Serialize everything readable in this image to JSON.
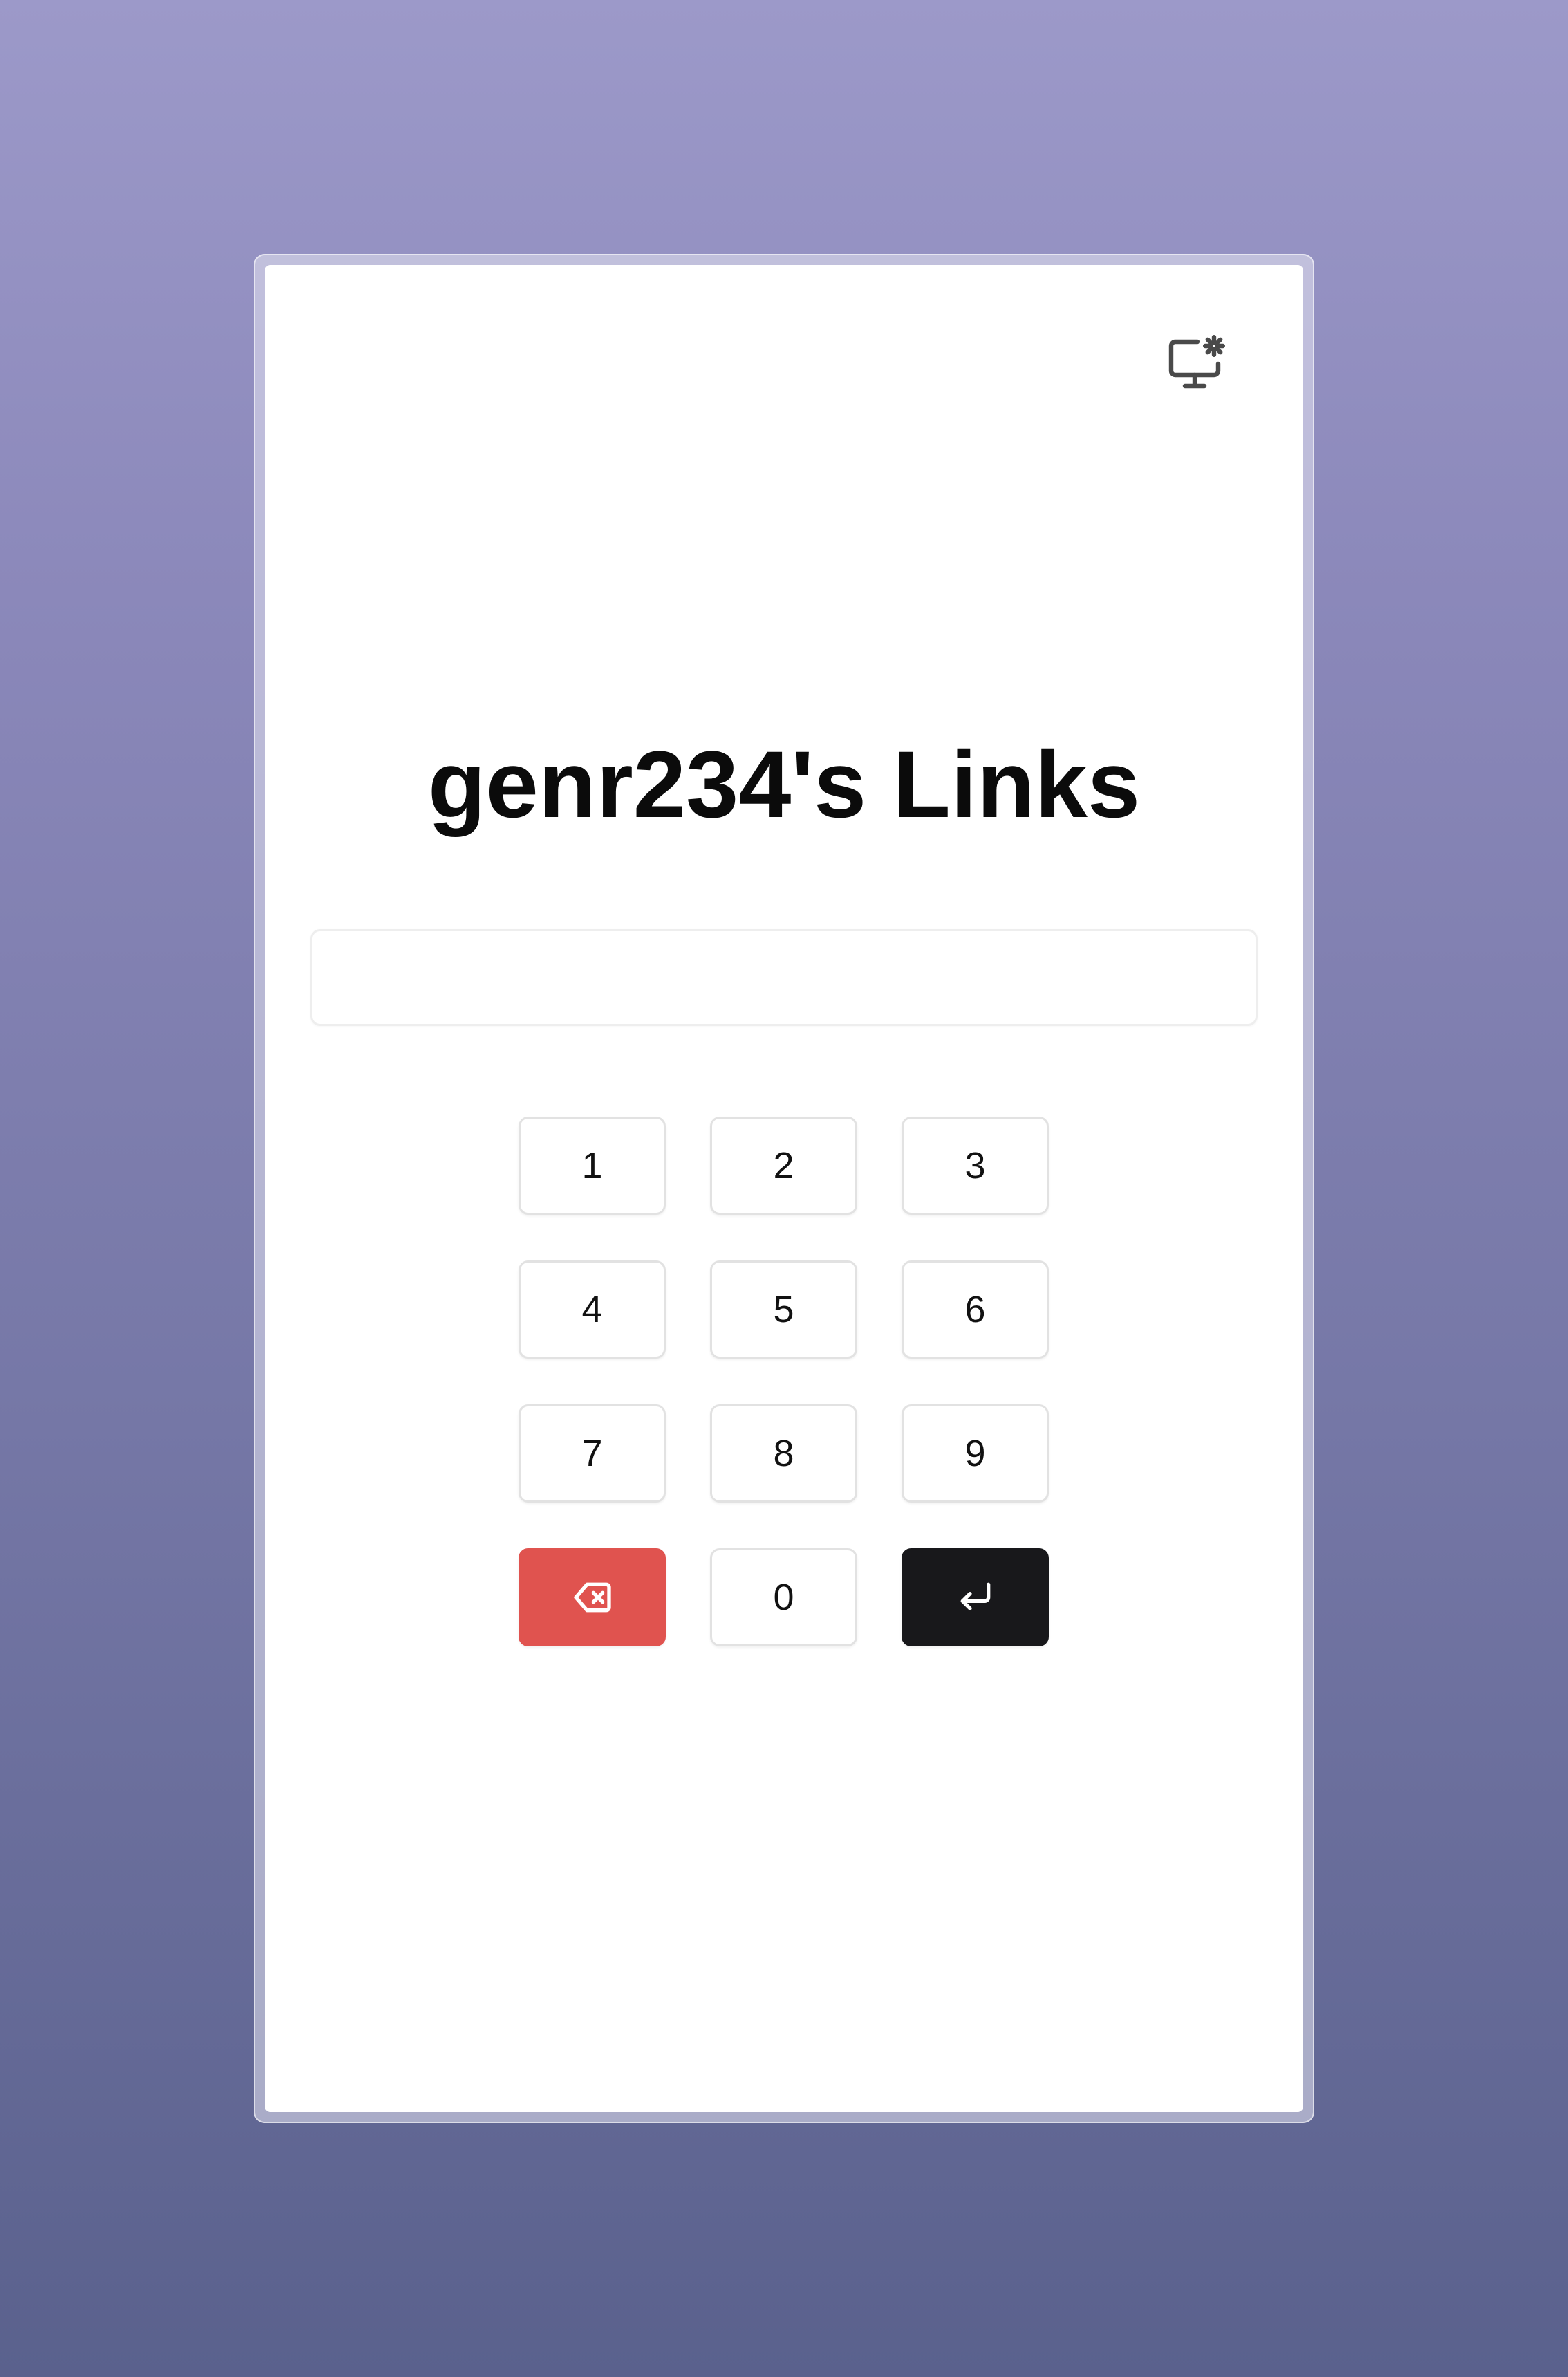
{
  "page": {
    "title": "genr234's Links"
  },
  "settings": {
    "icon": "monitor-settings-icon"
  },
  "pin_input": {
    "value": "",
    "placeholder": ""
  },
  "keypad": {
    "keys": [
      "1",
      "2",
      "3",
      "4",
      "5",
      "6",
      "7",
      "8",
      "9",
      "0"
    ],
    "delete_icon": "backspace-icon",
    "enter_icon": "enter-return-icon"
  },
  "colors": {
    "delete_button": "#e0534f",
    "enter_button": "#18181b",
    "background_top": "#9c99c9",
    "background_bottom": "#5a618d"
  }
}
